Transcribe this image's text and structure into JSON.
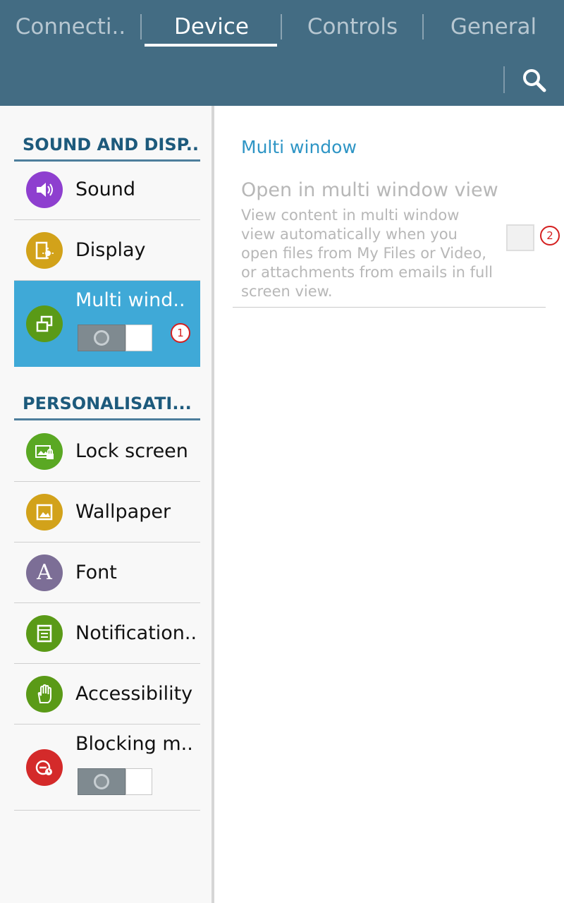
{
  "header": {
    "tabs": [
      {
        "label": "Connecti..",
        "active": false
      },
      {
        "label": "Device",
        "active": true
      },
      {
        "label": "Controls",
        "active": false
      },
      {
        "label": "General",
        "active": false
      }
    ],
    "search_icon": "search-icon"
  },
  "sidebar": {
    "sections": [
      {
        "title": "SOUND AND DISP...",
        "items": [
          {
            "label": "Sound",
            "icon": "speaker-icon",
            "color": "#8e3fcf"
          },
          {
            "label": "Display",
            "icon": "display-icon",
            "color": "#d2a21a"
          },
          {
            "label": "Multi wind..",
            "icon": "multi-window-icon",
            "color": "#5a9a17",
            "selected": true,
            "toggle": "off",
            "badge": "1"
          }
        ]
      },
      {
        "title": "PERSONALISATI...",
        "items": [
          {
            "label": "Lock screen",
            "icon": "lock-screen-icon",
            "color": "#5aa823"
          },
          {
            "label": "Wallpaper",
            "icon": "wallpaper-icon",
            "color": "#d2a21a"
          },
          {
            "label": "Font",
            "icon": "font-icon",
            "color": "#7c6e96",
            "glyph": "A"
          },
          {
            "label": "Notification..",
            "icon": "notification-icon",
            "color": "#5a9a17"
          },
          {
            "label": "Accessibility",
            "icon": "accessibility-hand-icon",
            "color": "#5a9a17"
          },
          {
            "label": "Blocking m..",
            "icon": "blocking-mode-icon",
            "color": "#d42a2a",
            "toggle": "off"
          }
        ]
      }
    ]
  },
  "detail": {
    "title": "Multi window",
    "setting": {
      "title": "Open in multi window view",
      "description": "View content in multi window view automatically when you open files from My Files or Video, or attachments from emails in full screen view.",
      "checked": false,
      "badge": "2"
    }
  },
  "colors": {
    "header_bg": "#436c83",
    "accent": "#3fa9d7",
    "section_text": "#1d5a7c",
    "detail_title": "#2e95c5"
  }
}
